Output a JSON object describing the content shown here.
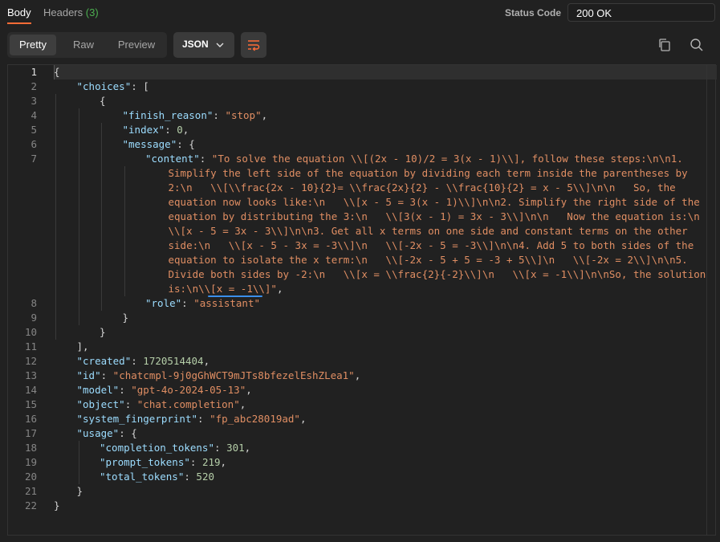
{
  "tabs": {
    "body_label": "Body",
    "headers_label": "Headers",
    "headers_count": "(3)"
  },
  "status": {
    "label": "Status Code",
    "value": "200 OK"
  },
  "toolbar": {
    "pretty_label": "Pretty",
    "raw_label": "Raw",
    "preview_label": "Preview",
    "format_label": "JSON",
    "icons": [
      "wrap-lines-icon",
      "copy-icon",
      "search-icon"
    ]
  },
  "colors": {
    "accent": "#ff6c37",
    "key": "#9cdcfe",
    "string": "#e08e63",
    "number": "#b5cea8",
    "headers_count": "#4caf50"
  },
  "editor": {
    "line_numbers": [
      "1",
      "2",
      "3",
      "4",
      "5",
      "6",
      "7",
      "8",
      "9",
      "10",
      "11",
      "12",
      "13",
      "14",
      "15",
      "16",
      "17",
      "18",
      "19",
      "20",
      "21",
      "22"
    ],
    "rows": [
      {
        "ln": "1",
        "indent": 0,
        "t": [
          [
            "p",
            "{"
          ]
        ]
      },
      {
        "ln": "2",
        "indent": 1,
        "t": [
          [
            "k",
            "\"choices\""
          ],
          [
            "p",
            ": ["
          ]
        ]
      },
      {
        "ln": "3",
        "indent": 2,
        "t": [
          [
            "p",
            "{"
          ]
        ]
      },
      {
        "ln": "4",
        "indent": 3,
        "t": [
          [
            "k",
            "\"finish_reason\""
          ],
          [
            "p",
            ": "
          ],
          [
            "s",
            "\"stop\""
          ],
          [
            "p",
            ","
          ]
        ]
      },
      {
        "ln": "5",
        "indent": 3,
        "t": [
          [
            "k",
            "\"index\""
          ],
          [
            "p",
            ": "
          ],
          [
            "n",
            "0"
          ],
          [
            "p",
            ","
          ]
        ]
      },
      {
        "ln": "6",
        "indent": 3,
        "t": [
          [
            "k",
            "\"message\""
          ],
          [
            "p",
            ": {"
          ]
        ]
      },
      {
        "ln": "7",
        "indent": 4,
        "t": [
          [
            "k",
            "\"content\""
          ],
          [
            "p",
            ": "
          ],
          [
            "s",
            "\"To solve the equation \\\\[(2x - 10)/2 = 3(x - 1)\\\\], follow these steps:\\n\\n1."
          ]
        ]
      },
      {
        "ln": "",
        "indent": 5,
        "t": [
          [
            "s",
            "Simplify the left side of the equation by dividing each term inside the parentheses by"
          ]
        ]
      },
      {
        "ln": "",
        "indent": 5,
        "t": [
          [
            "s",
            "2:\\n   \\\\[\\\\frac{2x - 10}{2}= \\\\frac{2x}{2} - \\\\frac{10}{2} = x - 5\\\\]\\n\\n   So, the"
          ]
        ]
      },
      {
        "ln": "",
        "indent": 5,
        "t": [
          [
            "s",
            "equation now looks like:\\n   \\\\[x - 5 = 3(x - 1)\\\\]\\n\\n2. Simplify the right side of the"
          ]
        ]
      },
      {
        "ln": "",
        "indent": 5,
        "t": [
          [
            "s",
            "equation by distributing the 3:\\n   \\\\[3(x - 1) = 3x - 3\\\\]\\n\\n   Now the equation is:\\n"
          ]
        ]
      },
      {
        "ln": "",
        "indent": 5,
        "t": [
          [
            "s",
            "\\\\[x - 5 = 3x - 3\\\\]\\n\\n3. Get all x terms on one side and constant terms on the other"
          ]
        ]
      },
      {
        "ln": "",
        "indent": 5,
        "t": [
          [
            "s",
            "side:\\n   \\\\[x - 5 - 3x = -3\\\\]\\n   \\\\[-2x - 5 = -3\\\\]\\n\\n4. Add 5 to both sides of the"
          ]
        ]
      },
      {
        "ln": "",
        "indent": 5,
        "t": [
          [
            "s",
            "equation to isolate the x term:\\n   \\\\[-2x - 5 + 5 = -3 + 5\\\\]\\n   \\\\[-2x = 2\\\\]\\n\\n5."
          ]
        ]
      },
      {
        "ln": "",
        "indent": 5,
        "t": [
          [
            "s",
            "Divide both sides by -2:\\n   \\\\[x = \\\\frac{2}{-2}\\\\]\\n   \\\\[x = -1\\\\]\\n\\nSo, the solution"
          ]
        ]
      },
      {
        "ln": "",
        "indent": 5,
        "t": [
          [
            "s",
            "is:\\n\\\\[x = -1\\\\]\""
          ],
          [
            "p",
            ","
          ]
        ]
      },
      {
        "ln": "8",
        "indent": 4,
        "t": [
          [
            "k",
            "\"role\""
          ],
          [
            "p",
            ": "
          ],
          [
            "s",
            "\"assistant\""
          ]
        ]
      },
      {
        "ln": "9",
        "indent": 3,
        "t": [
          [
            "p",
            "}"
          ]
        ]
      },
      {
        "ln": "10",
        "indent": 2,
        "t": [
          [
            "p",
            "}"
          ]
        ]
      },
      {
        "ln": "11",
        "indent": 1,
        "t": [
          [
            "p",
            "],"
          ]
        ]
      },
      {
        "ln": "12",
        "indent": 1,
        "t": [
          [
            "k",
            "\"created\""
          ],
          [
            "p",
            ": "
          ],
          [
            "n",
            "1720514404"
          ],
          [
            "p",
            ","
          ]
        ]
      },
      {
        "ln": "13",
        "indent": 1,
        "t": [
          [
            "k",
            "\"id\""
          ],
          [
            "p",
            ": "
          ],
          [
            "s",
            "\"chatcmpl-9j0gGhWCT9mJTs8bfezelEshZLea1\""
          ],
          [
            "p",
            ","
          ]
        ]
      },
      {
        "ln": "14",
        "indent": 1,
        "t": [
          [
            "k",
            "\"model\""
          ],
          [
            "p",
            ": "
          ],
          [
            "s",
            "\"gpt-4o-2024-05-13\""
          ],
          [
            "p",
            ","
          ]
        ]
      },
      {
        "ln": "15",
        "indent": 1,
        "t": [
          [
            "k",
            "\"object\""
          ],
          [
            "p",
            ": "
          ],
          [
            "s",
            "\"chat.completion\""
          ],
          [
            "p",
            ","
          ]
        ]
      },
      {
        "ln": "16",
        "indent": 1,
        "t": [
          [
            "k",
            "\"system_fingerprint\""
          ],
          [
            "p",
            ": "
          ],
          [
            "s",
            "\"fp_abc28019ad\""
          ],
          [
            "p",
            ","
          ]
        ]
      },
      {
        "ln": "17",
        "indent": 1,
        "t": [
          [
            "k",
            "\"usage\""
          ],
          [
            "p",
            ": {"
          ]
        ]
      },
      {
        "ln": "18",
        "indent": 2,
        "t": [
          [
            "k",
            "\"completion_tokens\""
          ],
          [
            "p",
            ": "
          ],
          [
            "n",
            "301"
          ],
          [
            "p",
            ","
          ]
        ]
      },
      {
        "ln": "19",
        "indent": 2,
        "t": [
          [
            "k",
            "\"prompt_tokens\""
          ],
          [
            "p",
            ": "
          ],
          [
            "n",
            "219"
          ],
          [
            "p",
            ","
          ]
        ]
      },
      {
        "ln": "20",
        "indent": 2,
        "t": [
          [
            "k",
            "\"total_tokens\""
          ],
          [
            "p",
            ": "
          ],
          [
            "n",
            "520"
          ]
        ]
      },
      {
        "ln": "21",
        "indent": 1,
        "t": [
          [
            "p",
            "}"
          ]
        ]
      },
      {
        "ln": "22",
        "indent": 0,
        "t": [
          [
            "p",
            "}"
          ]
        ]
      }
    ]
  }
}
